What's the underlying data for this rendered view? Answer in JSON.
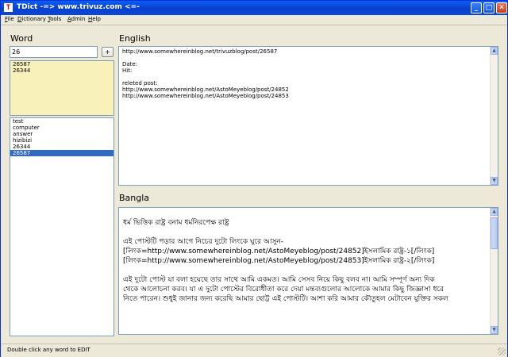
{
  "window": {
    "title": "TDict -=> www.trivuz.com <=-",
    "app_icon": "T",
    "minimize_glyph": "_",
    "maximize_glyph": "□",
    "close_glyph": "✕"
  },
  "menu": [
    {
      "label": "File"
    },
    {
      "label": "Dictionary"
    },
    {
      "label": "Tools"
    },
    {
      "label": "Admin"
    },
    {
      "label": "Help"
    }
  ],
  "word_panel": {
    "title": "Word",
    "search_value": "26",
    "add_button_label": "+",
    "suggestions": [
      "26587",
      "26344"
    ],
    "words": [
      "test",
      "computer",
      "answer",
      "hizibizi",
      "26344",
      "26587"
    ],
    "selected_word": "26587"
  },
  "english_panel": {
    "title": "English",
    "lines": [
      "http://www.somewhereinblog.net/trivuzblog/post/26587",
      "",
      "Date:",
      "Hit:",
      "",
      "releted post:",
      "http://www.somewhereinblog.net/AstoMeyeblog/post/24852",
      "http://www.somewhereinblog.net/AstoMeyeblog/post/24853"
    ]
  },
  "bangla_panel": {
    "title": "Bangla",
    "lines": [
      "",
      "ধর্ম ভিত্তিক রাষ্ট্র বনাম ধর্মনিরপেক্ষ রাষ্ট্র",
      "",
      "এই পোস্টটি পড়ার আগে নিচের দুটো লিংকে ঘুরে আসুন-",
      "[লিংক=http://www.somewhereinblog.net/AstoMeyeblog/post/24852]ইসলামিক রাষ্ট্র-১[/লিংক]",
      "[লিংক=http://www.somewhereinblog.net/AstoMeyeblog/post/24853]ইসলামিক রাষ্ট্র-২[/লিংক]",
      "",
      "এই দুটো পোস্ট যা বলা হয়েছে তার সাথে আমি একমত। আমি সেসব নিয়ে কিছু বলব না। আমি সম্পূর্ণ অন্য দিক",
      "থেকে আলোচনা করব। যা এ দুটো পোস্টের বিরোধীতা করে দেয়া মন্তব্যগুলোর আলোকে আমার কিছু জিজ্ঞাসা ধরে",
      "নিতে পারেন। শুধুই জানার জন্য করেছি আমার ছোট্ট এই পোস্টটি। আশা করি আমার কৌতুহল মেটাবেন যুক্তির সকল"
    ]
  },
  "status_bar": {
    "text": "Double click any word to EDIT"
  }
}
